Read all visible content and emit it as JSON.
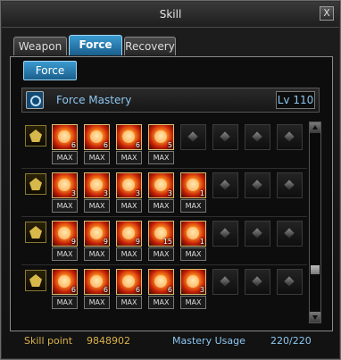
{
  "window": {
    "title": "Skill",
    "close": "X"
  },
  "tabs": [
    {
      "label": "Weapon"
    },
    {
      "label": "Force"
    },
    {
      "label": "Recovery"
    }
  ],
  "subtab": {
    "label": "Force"
  },
  "mastery": {
    "name": "Force Mastery",
    "level": "Lv 110"
  },
  "rows": [
    {
      "skills": [
        {
          "level": "6",
          "max": "MAX"
        },
        {
          "level": "6",
          "max": "MAX"
        },
        {
          "level": "6",
          "max": "MAX"
        },
        {
          "level": "5",
          "max": "MAX"
        }
      ]
    },
    {
      "skills": [
        {
          "level": "3",
          "max": "MAX"
        },
        {
          "level": "3",
          "max": "MAX"
        },
        {
          "level": "3",
          "max": "MAX"
        },
        {
          "level": "3",
          "max": "MAX"
        },
        {
          "level": "1",
          "max": "MAX"
        }
      ]
    },
    {
      "skills": [
        {
          "level": "9",
          "max": "MAX"
        },
        {
          "level": "9",
          "max": "MAX"
        },
        {
          "level": "9",
          "max": "MAX"
        },
        {
          "level": "15",
          "max": "MAX"
        },
        {
          "level": "1",
          "max": "MAX"
        }
      ]
    },
    {
      "skills": [
        {
          "level": "6",
          "max": "MAX"
        },
        {
          "level": "6",
          "max": "MAX"
        },
        {
          "level": "6",
          "max": "MAX"
        },
        {
          "level": "6",
          "max": "MAX"
        },
        {
          "level": "3",
          "max": "MAX"
        }
      ]
    }
  ],
  "footer": {
    "skill_point_label": "Skill point",
    "skill_point_value": "9848902",
    "mastery_usage_label": "Mastery Usage",
    "mastery_usage_value": "220/220"
  },
  "colors": {
    "accent": "#3a9ad0",
    "gold": "#d8b24a",
    "text_blue": "#8cc6f0"
  }
}
